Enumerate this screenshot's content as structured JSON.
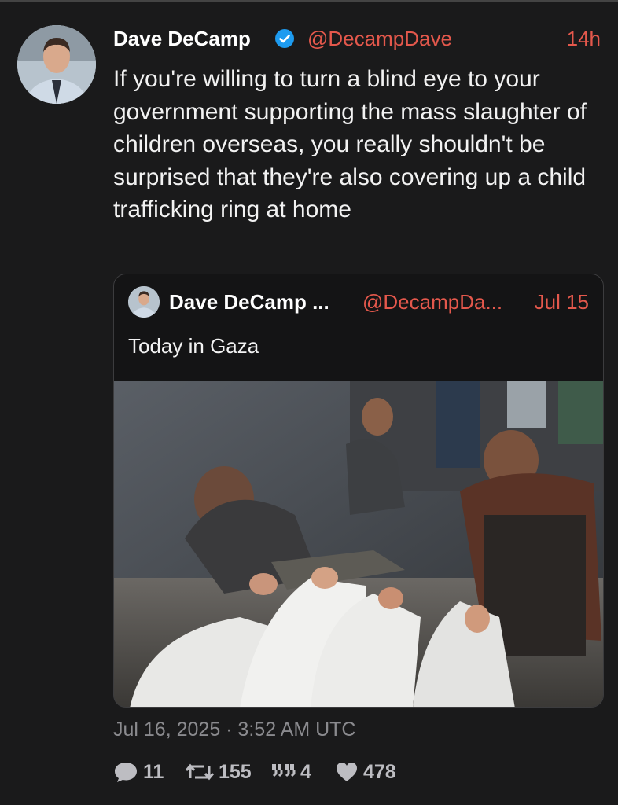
{
  "tweet": {
    "author_name": "Dave DeCamp",
    "handle": "@DecampDave",
    "relative_time": "14h",
    "text": "If you're willing to turn a blind eye to your government supporting the mass slaughter of children overseas, you really shouldn't be surprised that they're also covering up a child trafficking ring at home",
    "timestamp": "Jul 16, 2025 · 3:52 AM UTC",
    "stats": {
      "replies": "11",
      "retweets": "155",
      "quotes": "4",
      "likes": "478"
    }
  },
  "quoted_tweet": {
    "author_name": "Dave DeCamp ...",
    "handle": "@DecampDa...",
    "date": "Jul 15",
    "text": "Today in Gaza"
  },
  "icons": {
    "verified": "verified-badge-icon",
    "reply": "speech-bubble-icon",
    "retweet": "retweet-arrows-icon",
    "quote": "quote-marks-icon",
    "like": "heart-icon"
  },
  "colors": {
    "background": "#1a1a1b",
    "accent": "#e4584c",
    "verified": "#1d9bf0",
    "muted": "#8a8a8e"
  }
}
